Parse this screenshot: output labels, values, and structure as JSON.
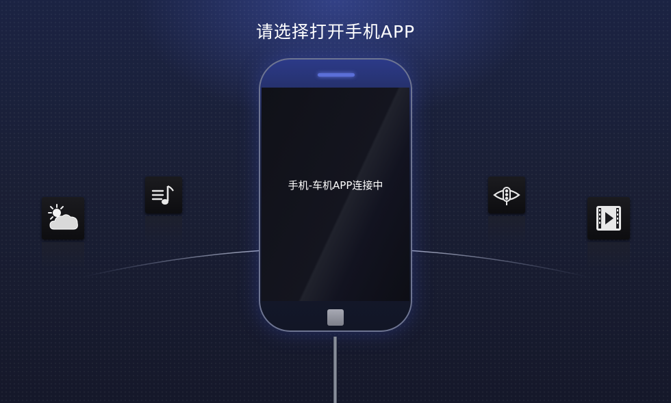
{
  "header": {
    "title": "请选择打开手机APP"
  },
  "phone": {
    "status_text": "手机-车机APP连接中"
  },
  "apps": [
    {
      "name": "weather-app",
      "icon": "weather-icon"
    },
    {
      "name": "music-app",
      "icon": "music-list-icon"
    },
    {
      "name": "navigation-app",
      "icon": "navigation-icon"
    },
    {
      "name": "video-app",
      "icon": "video-play-icon"
    }
  ],
  "colors": {
    "accent_glow": "#5b6fd8",
    "background": "#1a1f35"
  }
}
